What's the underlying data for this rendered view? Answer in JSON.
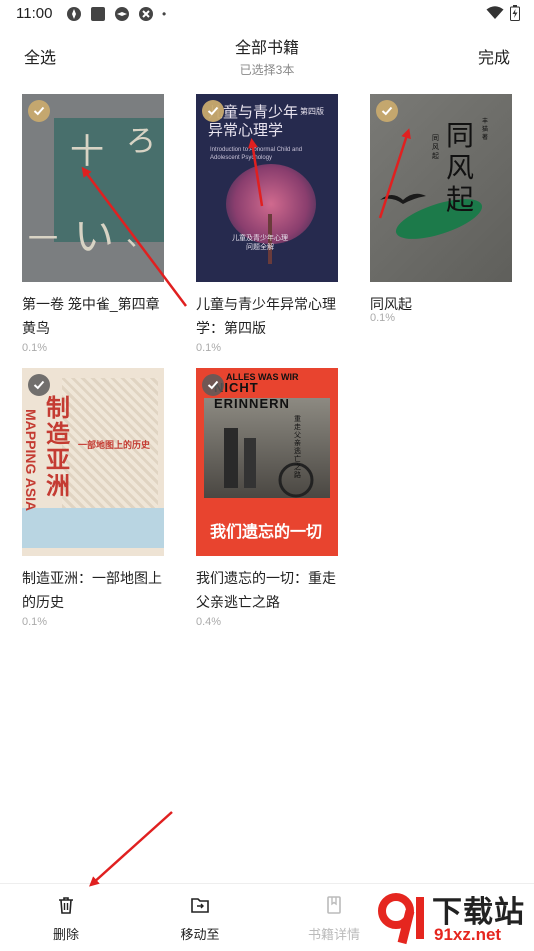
{
  "status_bar": {
    "time": "11:00",
    "dot": "•"
  },
  "header": {
    "select_all": "全选",
    "title": "全部书籍",
    "subtitle": "已选择3本",
    "done": "完成"
  },
  "books": [
    {
      "title": "第一卷 笼中雀_第四章 黄鸟",
      "progress": "0.1%",
      "selected": true,
      "cover_colors": [
        "#7d8184",
        "#2e6a66"
      ]
    },
    {
      "title": "儿童与青少年异常心理学：第四版",
      "progress": "0.1%",
      "selected": true,
      "cover_colors": [
        "#262a4e",
        "#b2557a"
      ]
    },
    {
      "title": "同风起",
      "progress": "0.1%",
      "selected": true,
      "cover_colors": [
        "#6e6e6a",
        "#1c7a4a"
      ]
    },
    {
      "title": "制造亚洲：一部地图上的历史",
      "progress": "0.1%",
      "selected": false,
      "cover_colors": [
        "#eee3d4",
        "#c43b32"
      ]
    },
    {
      "title": "我们遗忘的一切：重走父亲逃亡之路",
      "progress": "0.4%",
      "selected": false,
      "cover_colors": [
        "#e8442f",
        "#3a3a3a"
      ]
    }
  ],
  "cover_text": {
    "book1": [
      "十",
      "ろ",
      "一",
      "い",
      "、"
    ],
    "book2": {
      "main": "儿童与青少年异常心理学",
      "edition": "第四版",
      "en": "Introduction to Abnormal Child and Adolescent Psychology",
      "sub": "儿童及青少年心理问题全解"
    },
    "book3": {
      "main": "同风起",
      "side": "同风起",
      "author": "丰 猫 著"
    },
    "book4": {
      "main": "制造亚洲",
      "en": "MAPPING ASIA",
      "sub": "一部地图上的历史"
    },
    "book5": {
      "top": "ALLES WAS WIR",
      "big": "NICHT ERINNERN",
      "main": "我们遗忘的一切",
      "sub": "重走父亲逃亡之路"
    }
  },
  "bottom_bar": {
    "delete": "删除",
    "move_to": "移动至",
    "details": "书籍详情"
  },
  "watermark": {
    "text": "下载站",
    "url": "91xz.net"
  },
  "accent_color": "#c8aa6e"
}
